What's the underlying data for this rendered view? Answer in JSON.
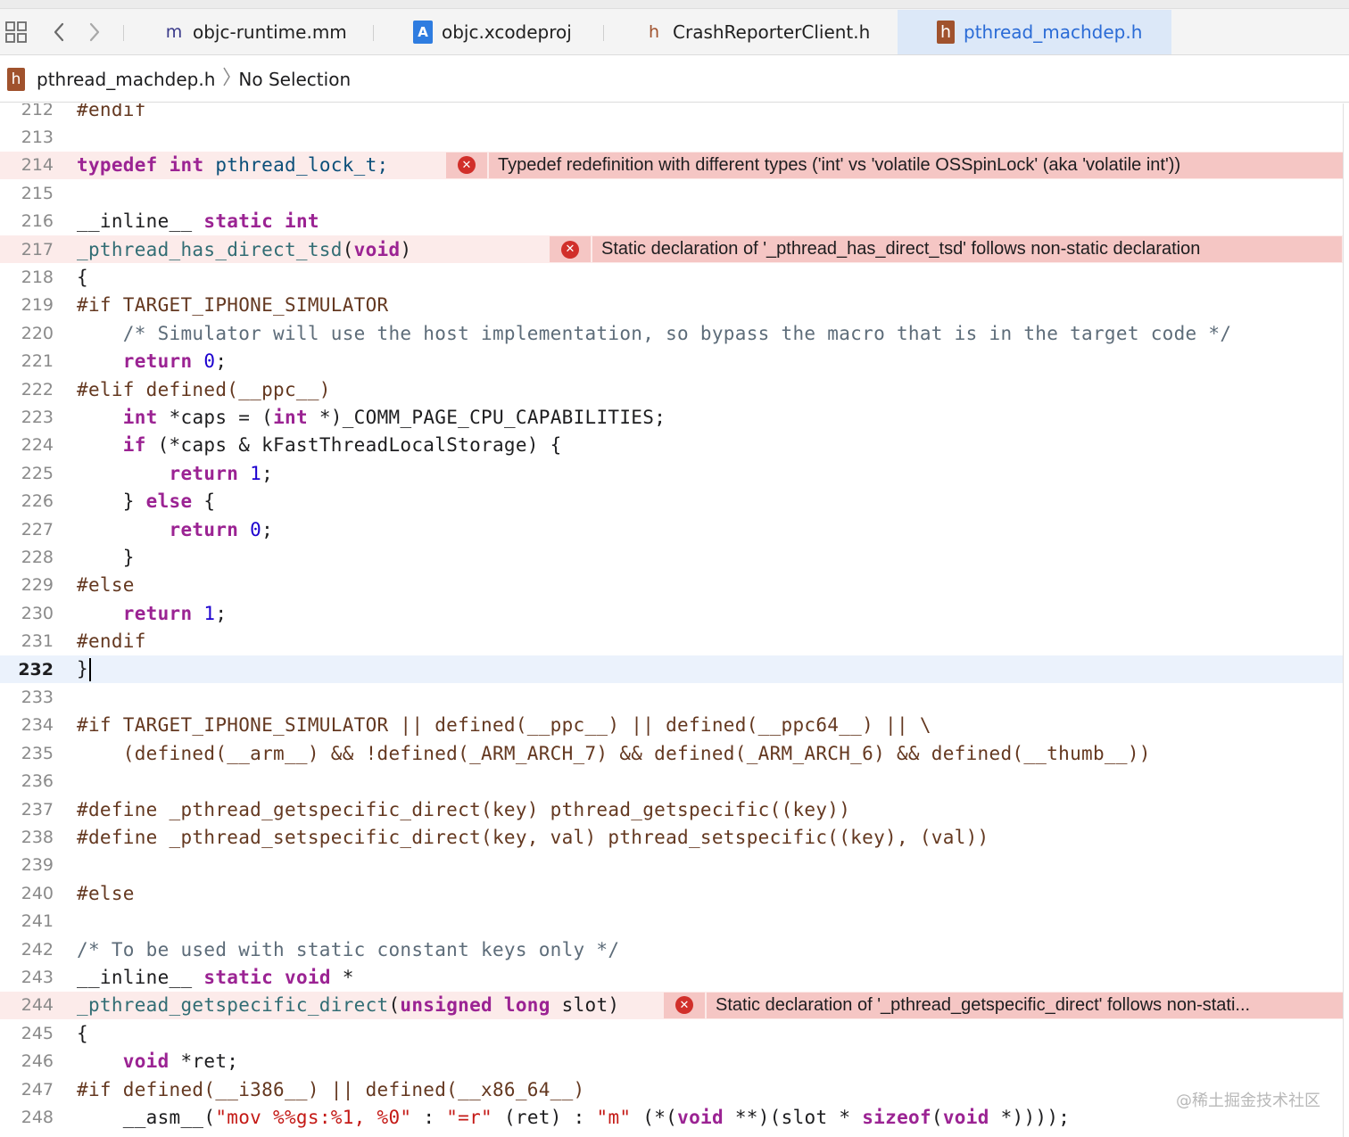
{
  "tabs": [
    {
      "label": "objc-runtime.mm",
      "icon": "m"
    },
    {
      "label": "objc.xcodeproj",
      "icon": "A"
    },
    {
      "label": "CrashReporterClient.h",
      "icon": "h"
    },
    {
      "label": "pthread_machdep.h",
      "icon": "h",
      "active": true
    }
  ],
  "jumpbar": {
    "file": "pthread_machdep.h",
    "selection": "No Selection",
    "icon": "h"
  },
  "errors": {
    "e214": "Typedef redefinition with different types ('int' vs 'volatile OSSpinLock' (aka 'volatile int'))",
    "e217": "Static declaration of '_pthread_has_direct_tsd' follows non-static declaration",
    "e244": "Static declaration of '_pthread_getspecific_direct' follows non-stati..."
  },
  "error_icon": "✕",
  "code": {
    "l212": {
      "n": "212",
      "t": "#endif"
    },
    "l213": {
      "n": "213",
      "t": ""
    },
    "l214": {
      "n": "214",
      "a": "typedef",
      "b": " ",
      "c": "int",
      "d": " pthread_lock_t;"
    },
    "l215": {
      "n": "215",
      "t": ""
    },
    "l216": {
      "n": "216",
      "a": "__inline__ ",
      "b": "static",
      "c": " ",
      "d": "int"
    },
    "l217": {
      "n": "217",
      "a": "_pthread_has_direct_tsd",
      "b": "(",
      "c": "void",
      "d": ")"
    },
    "l218": {
      "n": "218",
      "t": "{"
    },
    "l219": {
      "n": "219",
      "t": "#if TARGET_IPHONE_SIMULATOR"
    },
    "l220": {
      "n": "220",
      "t": "    /* Simulator will use the host implementation, so bypass the macro that is in the target code */"
    },
    "l221": {
      "n": "221",
      "a": "    ",
      "b": "return",
      "c": " ",
      "d": "0",
      "e": ";"
    },
    "l222": {
      "n": "222",
      "t": "#elif defined(__ppc__)"
    },
    "l223": {
      "n": "223",
      "a": "    ",
      "b": "int",
      "c": " *caps = (",
      "d": "int",
      "e": " *)_COMM_PAGE_CPU_CAPABILITIES;"
    },
    "l224": {
      "n": "224",
      "a": "    ",
      "b": "if",
      "c": " (*caps & kFastThreadLocalStorage) {"
    },
    "l225": {
      "n": "225",
      "a": "        ",
      "b": "return",
      "c": " ",
      "d": "1",
      "e": ";"
    },
    "l226": {
      "n": "226",
      "a": "    } ",
      "b": "else",
      "c": " {"
    },
    "l227": {
      "n": "227",
      "a": "        ",
      "b": "return",
      "c": " ",
      "d": "0",
      "e": ";"
    },
    "l228": {
      "n": "228",
      "t": "    }"
    },
    "l229": {
      "n": "229",
      "t": "#else"
    },
    "l230": {
      "n": "230",
      "a": "    ",
      "b": "return",
      "c": " ",
      "d": "1",
      "e": ";"
    },
    "l231": {
      "n": "231",
      "t": "#endif"
    },
    "l232": {
      "n": "232",
      "t": "}"
    },
    "l233": {
      "n": "233",
      "t": ""
    },
    "l234": {
      "n": "234",
      "t": "#if TARGET_IPHONE_SIMULATOR || defined(__ppc__) || defined(__ppc64__) || \\"
    },
    "l235": {
      "n": "235",
      "t": "    (defined(__arm__) && !defined(_ARM_ARCH_7) && defined(_ARM_ARCH_6) && defined(__thumb__))"
    },
    "l236": {
      "n": "236",
      "t": ""
    },
    "l237": {
      "n": "237",
      "t": "#define _pthread_getspecific_direct(key) pthread_getspecific((key))"
    },
    "l238": {
      "n": "238",
      "t": "#define _pthread_setspecific_direct(key, val) pthread_setspecific((key), (val))"
    },
    "l239": {
      "n": "239",
      "t": ""
    },
    "l240": {
      "n": "240",
      "t": "#else"
    },
    "l241": {
      "n": "241",
      "t": ""
    },
    "l242": {
      "n": "242",
      "t": "/* To be used with static constant keys only */"
    },
    "l243": {
      "n": "243",
      "a": "__inline__ ",
      "b": "static",
      "c": " ",
      "d": "void",
      "e": " *"
    },
    "l244": {
      "n": "244",
      "a": "_pthread_getspecific_direct",
      "b": "(",
      "c": "unsigned long",
      "d": " slot)"
    },
    "l245": {
      "n": "245",
      "t": "{"
    },
    "l246": {
      "n": "246",
      "a": "    ",
      "b": "void",
      "c": " *ret;"
    },
    "l247": {
      "n": "247",
      "t": "#if defined(__i386__) || defined(__x86_64__)"
    },
    "l248": {
      "n": "248",
      "a": "    __asm__(",
      "b": "\"mov %%gs:%1, %0\"",
      "c": " : ",
      "d": "\"=r\"",
      "e": " (ret) : ",
      "f": "\"m\"",
      "g": " (*(",
      "h": "void",
      "i": " **)(slot * ",
      "j": "sizeof",
      "k": "(",
      "l": "void",
      "m": " *))));"
    }
  },
  "watermark": "@稀土掘金技术社区"
}
